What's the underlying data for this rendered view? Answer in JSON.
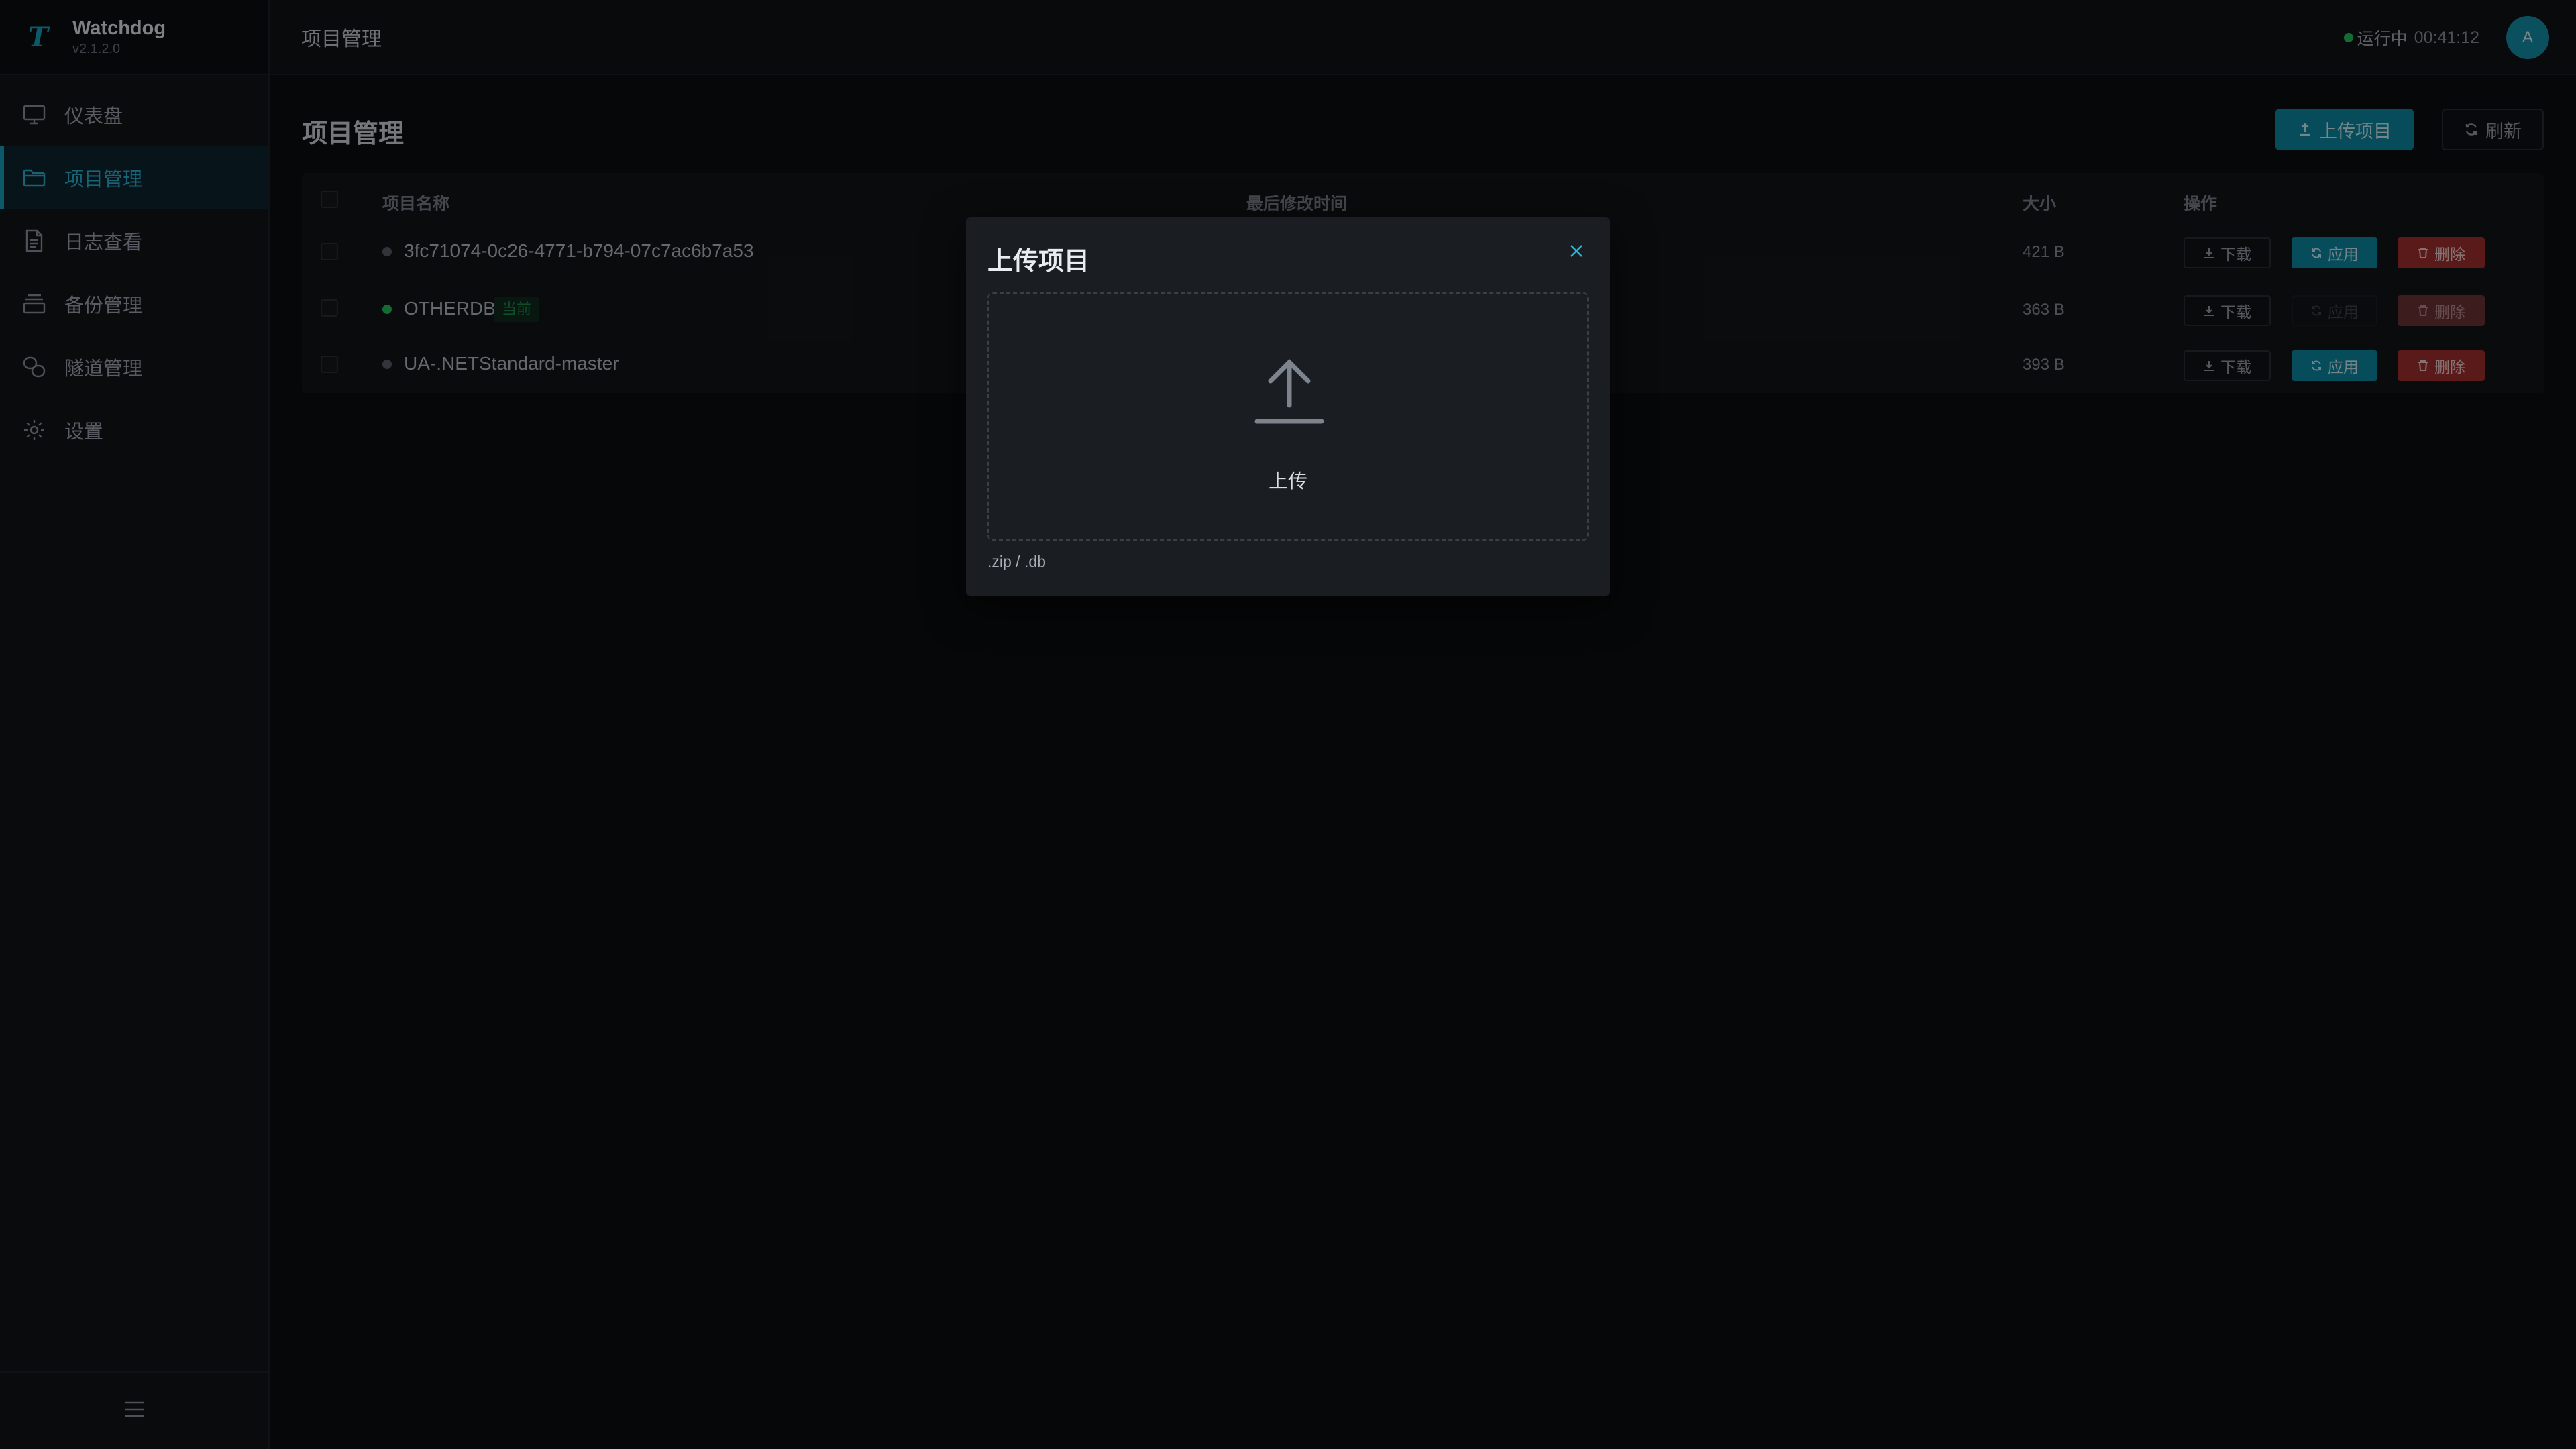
{
  "app": {
    "logo": "T",
    "name": "Watchdog",
    "version": "v2.1.2.0"
  },
  "sidebar": {
    "items": [
      {
        "label": "仪表盘",
        "icon": "monitor-icon",
        "active": false
      },
      {
        "label": "项目管理",
        "icon": "folder-icon",
        "active": true
      },
      {
        "label": "日志查看",
        "icon": "document-icon",
        "active": false
      },
      {
        "label": "备份管理",
        "icon": "archive-icon",
        "active": false
      },
      {
        "label": "隧道管理",
        "icon": "tunnel-icon",
        "active": false
      },
      {
        "label": "设置",
        "icon": "gear-icon",
        "active": false
      }
    ],
    "collapse_icon": "menu-icon"
  },
  "header": {
    "title": "项目管理",
    "status": "运行中",
    "uptime": "00:41:12",
    "avatar": "A"
  },
  "main": {
    "title": "项目管理",
    "upload_button": "上传项目",
    "refresh_button": "刷新",
    "table": {
      "columns": [
        "项目名称",
        "最后修改时间",
        "大小",
        "操作"
      ],
      "rows": [
        {
          "name": "3fc71074-0c26-4771-b794-07c7ac6b7a53",
          "tag": "",
          "size": "421 B",
          "current": false
        },
        {
          "name": "OTHERDB",
          "tag": "当前",
          "size": "363 B",
          "current": true
        },
        {
          "name": "UA-.NETStandard-master",
          "tag": "",
          "size": "393 B",
          "current": false
        }
      ],
      "actions": {
        "download": "下载",
        "apply": "应用",
        "delete": "删除"
      }
    }
  },
  "modal": {
    "title": "上传项目",
    "drop_label": "上传",
    "hint": ".zip / .db"
  },
  "colors": {
    "accent": "#0e8ba6",
    "danger": "#a5302f",
    "success": "#22c55e",
    "background": "#0b0d10"
  }
}
